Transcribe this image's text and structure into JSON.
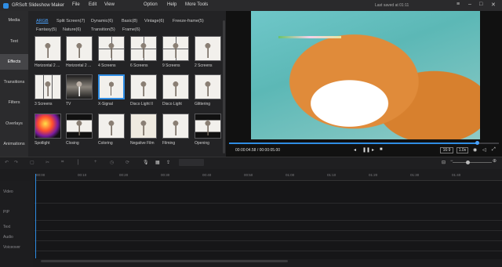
{
  "app": {
    "title": "GRSoft Slideshow Maker",
    "menu": [
      "File",
      "Edit",
      "View",
      "Option",
      "Help",
      "More Tools"
    ],
    "saved": "Last saved at 01:11"
  },
  "sidebar": {
    "items": [
      "Media",
      "Text",
      "Effects",
      "Transitions",
      "Filters",
      "Overlays",
      "Animations"
    ],
    "active": "Effects"
  },
  "effects": {
    "tabs_row1": [
      "ARGB",
      "Split Screen(7)",
      "Dynamic(6)",
      "Basic(8)",
      "Vintage(6)",
      "Freeze-frame(5)"
    ],
    "tabs_row2": [
      "Fantasy(5)",
      "Nature(6)",
      "Transition(5)",
      "Frame(6)"
    ],
    "active_tab": "ARGB",
    "items": [
      {
        "label": "Horizontal 2 ...",
        "style": "plain"
      },
      {
        "label": "Horizontal 2 ...",
        "style": "plain"
      },
      {
        "label": "4 Screens",
        "style": "grid4"
      },
      {
        "label": "6 Screens",
        "style": "grid4"
      },
      {
        "label": "9 Screens",
        "style": "grid4"
      },
      {
        "label": "2 Screens",
        "style": "plain"
      },
      {
        "label": "3 Screens",
        "style": "split3"
      },
      {
        "label": "TV",
        "style": "tv"
      },
      {
        "label": "X-Signal",
        "style": "xsig"
      },
      {
        "label": "Disco Light II",
        "style": "plain"
      },
      {
        "label": "Disco Light",
        "style": "plain"
      },
      {
        "label": "Glittering",
        "style": "plain"
      },
      {
        "label": "Spotlight",
        "style": "spot"
      },
      {
        "label": "Closing",
        "style": "closing"
      },
      {
        "label": "Coloring",
        "style": "plain"
      },
      {
        "label": "Negative Film",
        "style": "neg"
      },
      {
        "label": "Filming",
        "style": "plain"
      },
      {
        "label": "Opening",
        "style": "closing"
      }
    ]
  },
  "player": {
    "current": "00:00:04.58",
    "total": "00:00:05.00",
    "progress": 0.92,
    "ratio": "16:9",
    "speed": "1.0x"
  },
  "timeline": {
    "ruler": [
      "00:00",
      "00:10",
      "00:20",
      "00:30",
      "00:40",
      "00:50",
      "01:00",
      "01:10",
      "01:20",
      "01:30",
      "01:40"
    ],
    "tracks": [
      "Video",
      "PIP",
      "Text",
      "Audio",
      "Voiceover"
    ]
  },
  "colors": {
    "accent": "#2f8de4"
  }
}
